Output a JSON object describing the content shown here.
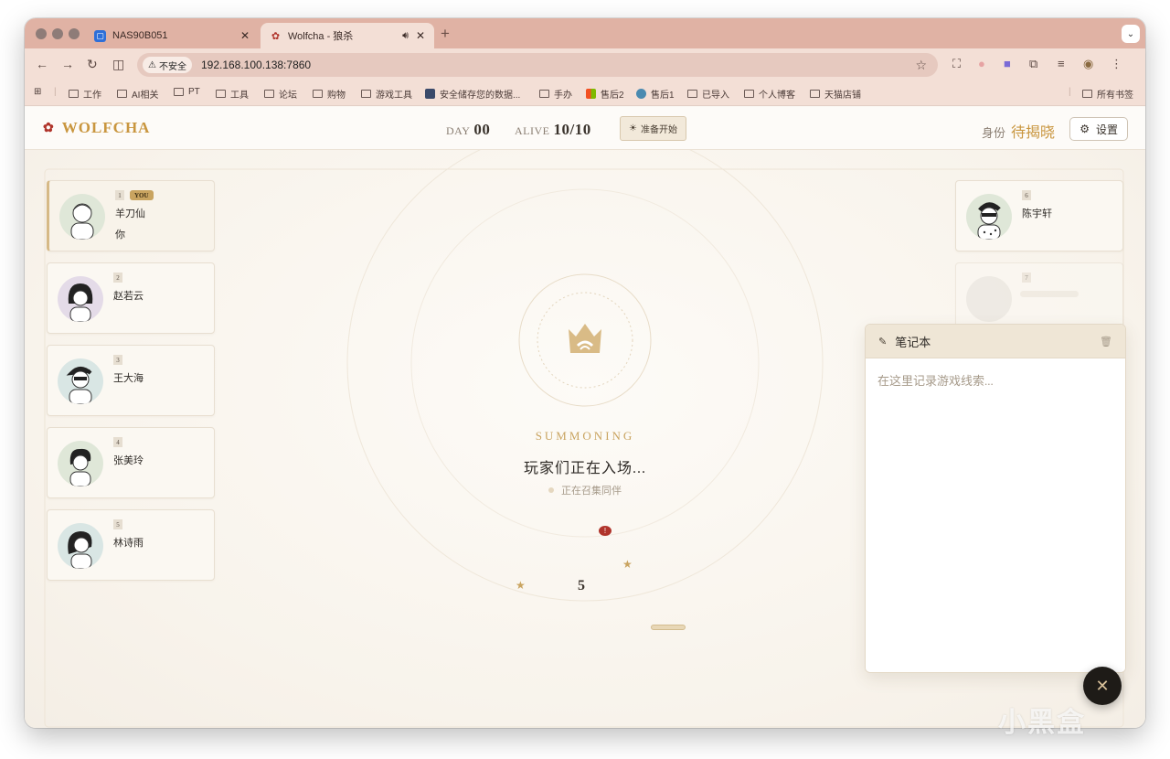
{
  "browser": {
    "tabs": [
      {
        "title": "NAS90B051",
        "active": false
      },
      {
        "title": "Wolfcha - 狼杀",
        "active": true
      }
    ],
    "new_tab": "+",
    "address": {
      "security_label": "不安全",
      "url": "192.168.100.138:7860"
    },
    "bookmarks": [
      {
        "label": "工作",
        "icon": "folder-icon"
      },
      {
        "label": "AI相关",
        "icon": "folder-icon"
      },
      {
        "label": "PT",
        "icon": "folder-icon"
      },
      {
        "label": "工具",
        "icon": "folder-icon"
      },
      {
        "label": "论坛",
        "icon": "folder-icon"
      },
      {
        "label": "购物",
        "icon": "folder-icon"
      },
      {
        "label": "游戏工具",
        "icon": "folder-icon"
      },
      {
        "label": "安全储存您的数据...",
        "icon": "site-icon"
      },
      {
        "label": "手办",
        "icon": "folder-icon"
      },
      {
        "label": "售后2",
        "icon": "windows-icon"
      },
      {
        "label": "售后1",
        "icon": "site-icon"
      },
      {
        "label": "已导入",
        "icon": "folder-icon"
      },
      {
        "label": "个人博客",
        "icon": "folder-icon"
      },
      {
        "label": "天猫店铺",
        "icon": "folder-icon"
      }
    ],
    "all_bookmarks": "所有书签"
  },
  "header": {
    "logo": "WOLFCHA",
    "day_label": "DAY",
    "day_value": "00",
    "alive_label": "ALIVE",
    "alive_value": "10/10",
    "ready_button": "准备开始",
    "role_label": "身份",
    "role_value": "待揭晓",
    "settings_button": "设置"
  },
  "players_left": [
    {
      "seat": "1",
      "name": "羊刀仙",
      "you_badge": "YOU",
      "sub": "你"
    },
    {
      "seat": "2",
      "name": "赵若云"
    },
    {
      "seat": "3",
      "name": "王大海"
    },
    {
      "seat": "4",
      "name": "张美玲"
    },
    {
      "seat": "5",
      "name": "林诗雨"
    }
  ],
  "players_right": [
    {
      "seat": "6",
      "name": "陈宇轩"
    },
    {
      "seat": "7",
      "name": ""
    }
  ],
  "center": {
    "status": "SUMMONING",
    "message": "玩家们正在入场...",
    "sub_message": "正在召集同伴",
    "counter": "5"
  },
  "notebook": {
    "title": "笔记本",
    "placeholder": "在这里记录游戏线索..."
  },
  "colors": {
    "accent": "#c9a460",
    "brand_red": "#b0342b",
    "tab_strip": "#e0b2a4"
  },
  "watermark": "小黑盒"
}
